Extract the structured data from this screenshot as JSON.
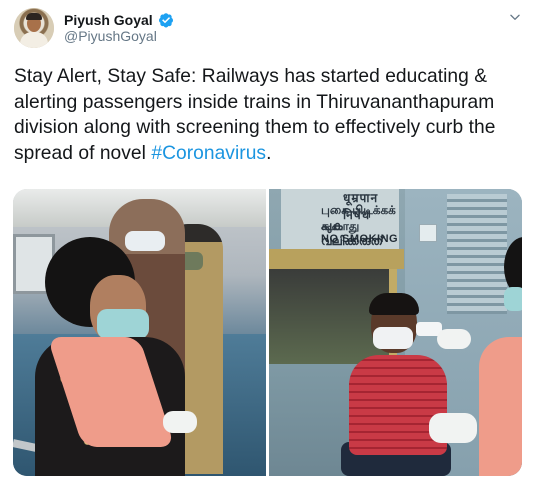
{
  "author": {
    "display_name": "Piyush Goyal",
    "handle": "@PiyushGoyal",
    "verified": true,
    "avatar_icon": "profile-photo"
  },
  "menu_icon": "chevron-down-icon",
  "tweet": {
    "text_before": "Stay Alert, Stay Safe: Railways has started educating & alerting passengers inside trains in Thiruvananthapuram division along with screening them to effectively curb the spread of novel ",
    "hashtag": "#Coronavirus",
    "text_after": "."
  },
  "media": {
    "photo_right_sign": {
      "line1": "धूम्रपान निषेध",
      "line2": "புகை பிடிக்கக் கூடாது",
      "line3": "പുക വലിക്കരുത്",
      "line4": "NO SMOKING"
    }
  },
  "colors": {
    "text": "#14171a",
    "secondary_text": "#657786",
    "link": "#1b95e0",
    "verified_badge": "#1da1f2"
  }
}
